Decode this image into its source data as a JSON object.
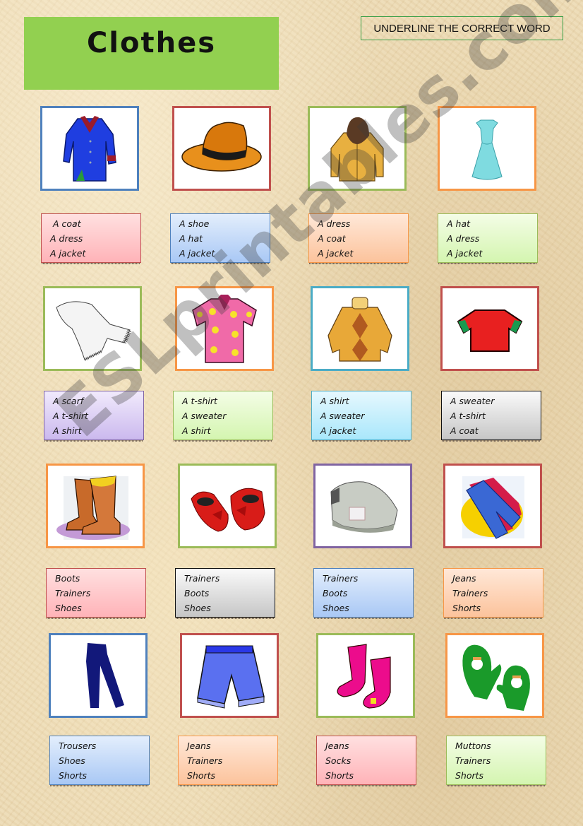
{
  "title": "Clothes",
  "instruction": "UNDERLINE THE CORRECT WORD",
  "watermark": "ESLprintables.com",
  "colors": {
    "title_bg": "#92d050",
    "instruction_border": "#3aa048",
    "frame_blue": "#4f81bd",
    "frame_red": "#c0504d",
    "frame_green": "#9bbb59",
    "frame_orange": "#f79646",
    "frame_teal": "#4bacc6",
    "frame_purple": "#8064a2"
  },
  "items": [
    {
      "picture": "coat-icon",
      "frame": "blue",
      "box": "pink",
      "options": [
        "A coat",
        "A dress",
        "A jacket"
      ]
    },
    {
      "picture": "hat-icon",
      "frame": "red",
      "box": "blue",
      "options": [
        "A shoe",
        "A hat",
        "A jacket"
      ]
    },
    {
      "picture": "jacket-icon",
      "frame": "green",
      "box": "orange",
      "options": [
        "A dress",
        "A coat",
        "A jacket"
      ]
    },
    {
      "picture": "dress-icon",
      "frame": "orange",
      "box": "green",
      "options": [
        "A hat",
        "A dress",
        "A jacket"
      ]
    },
    {
      "picture": "scarf-icon",
      "frame": "green",
      "box": "purple",
      "options": [
        "A scarf",
        "A t-shirt",
        "A shirt"
      ]
    },
    {
      "picture": "shirt-icon",
      "frame": "orange",
      "box": "green",
      "options": [
        "A t-shirt",
        "A sweater",
        "A shirt"
      ]
    },
    {
      "picture": "sweater-icon",
      "frame": "teal",
      "box": "cyan",
      "options": [
        "A shirt",
        "A sweater",
        "A jacket"
      ]
    },
    {
      "picture": "t-shirt-icon",
      "frame": "red",
      "box": "gray",
      "options": [
        "A sweater",
        "A t-shirt",
        "A coat"
      ]
    },
    {
      "picture": "boots-icon",
      "frame": "orange",
      "box": "pink",
      "options": [
        "Boots",
        "Trainers",
        "Shoes"
      ]
    },
    {
      "picture": "shoes-icon",
      "frame": "green",
      "box": "gray",
      "options": [
        "Trainers",
        "Boots",
        "Shoes"
      ]
    },
    {
      "picture": "trainers-icon",
      "frame": "purple",
      "box": "blue",
      "options": [
        "Trainers",
        "Boots",
        "Shoes"
      ]
    },
    {
      "picture": "jeans-icon",
      "frame": "red",
      "box": "orange",
      "options": [
        "Jeans",
        "Trainers",
        "Shorts"
      ]
    },
    {
      "picture": "trousers-icon",
      "frame": "blue",
      "box": "blue",
      "options": [
        "Trousers",
        "Shoes",
        "Shorts"
      ]
    },
    {
      "picture": "shorts-icon",
      "frame": "red",
      "box": "orange",
      "options": [
        "Jeans",
        "Trainers",
        "Shorts"
      ]
    },
    {
      "picture": "socks-icon",
      "frame": "green",
      "box": "pink",
      "options": [
        "Jeans",
        "Socks",
        "Shorts"
      ]
    },
    {
      "picture": "mittens-icon",
      "frame": "orange",
      "box": "green",
      "options": [
        "Muttons",
        "Trainers",
        "Shorts"
      ]
    }
  ]
}
